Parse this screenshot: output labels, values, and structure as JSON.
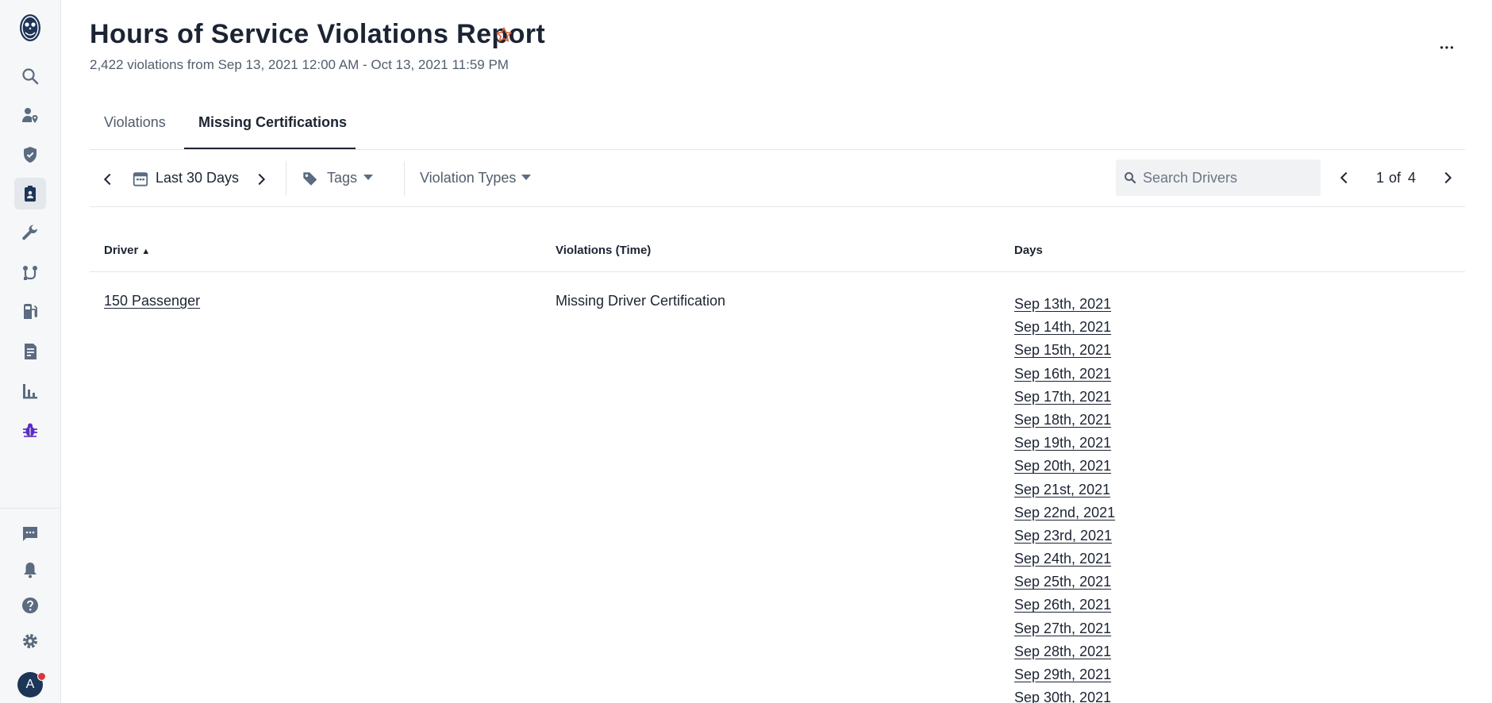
{
  "sidebar": {
    "logo": "owl-logo-icon",
    "items": [
      {
        "icon": "search-icon"
      },
      {
        "icon": "driver-location-icon"
      },
      {
        "icon": "shield-check-icon"
      },
      {
        "icon": "clipboard-badge-icon",
        "active": true
      },
      {
        "icon": "wrench-icon"
      },
      {
        "icon": "route-icon"
      },
      {
        "icon": "fuel-icon"
      },
      {
        "icon": "document-icon"
      },
      {
        "icon": "bar-chart-icon"
      },
      {
        "icon": "bug-icon"
      }
    ],
    "bottom_items": [
      {
        "icon": "chat-icon"
      },
      {
        "icon": "bell-icon"
      },
      {
        "icon": "help-icon"
      },
      {
        "icon": "gear-icon"
      }
    ],
    "avatar_initial": "A"
  },
  "header": {
    "title": "Hours of Service Violations Report",
    "subtitle": "2,422 violations from Sep 13, 2021 12:00 AM - Oct 13, 2021 11:59 PM"
  },
  "tabs": [
    {
      "label": "Violations",
      "active": false
    },
    {
      "label": "Missing Certifications",
      "active": true
    }
  ],
  "toolbar": {
    "date_range": "Last 30 Days",
    "tags_label": "Tags",
    "violation_types_label": "Violation Types",
    "search_placeholder": "Search Drivers",
    "page_current": "1",
    "page_of": "of",
    "page_total": "4"
  },
  "table": {
    "columns": [
      "Driver",
      "Violations (Time)",
      "Days"
    ],
    "sort_indicator": "▲",
    "rows": [
      {
        "driver": "150 Passenger",
        "violation": "Missing Driver Certification",
        "days": [
          "Sep 13th, 2021",
          "Sep 14th, 2021",
          "Sep 15th, 2021",
          "Sep 16th, 2021",
          "Sep 17th, 2021",
          "Sep 18th, 2021",
          "Sep 19th, 2021",
          "Sep 20th, 2021",
          "Sep 21st, 2021",
          "Sep 22nd, 2021",
          "Sep 23rd, 2021",
          "Sep 24th, 2021",
          "Sep 25th, 2021",
          "Sep 26th, 2021",
          "Sep 27th, 2021",
          "Sep 28th, 2021",
          "Sep 29th, 2021",
          "Sep 30th, 2021"
        ]
      }
    ]
  },
  "colors": {
    "accent_star": "#e0623a",
    "sidebar_icon": "#5b6b80",
    "bug_icon": "#5b2cc4",
    "notification_dot": "#d9363e"
  }
}
